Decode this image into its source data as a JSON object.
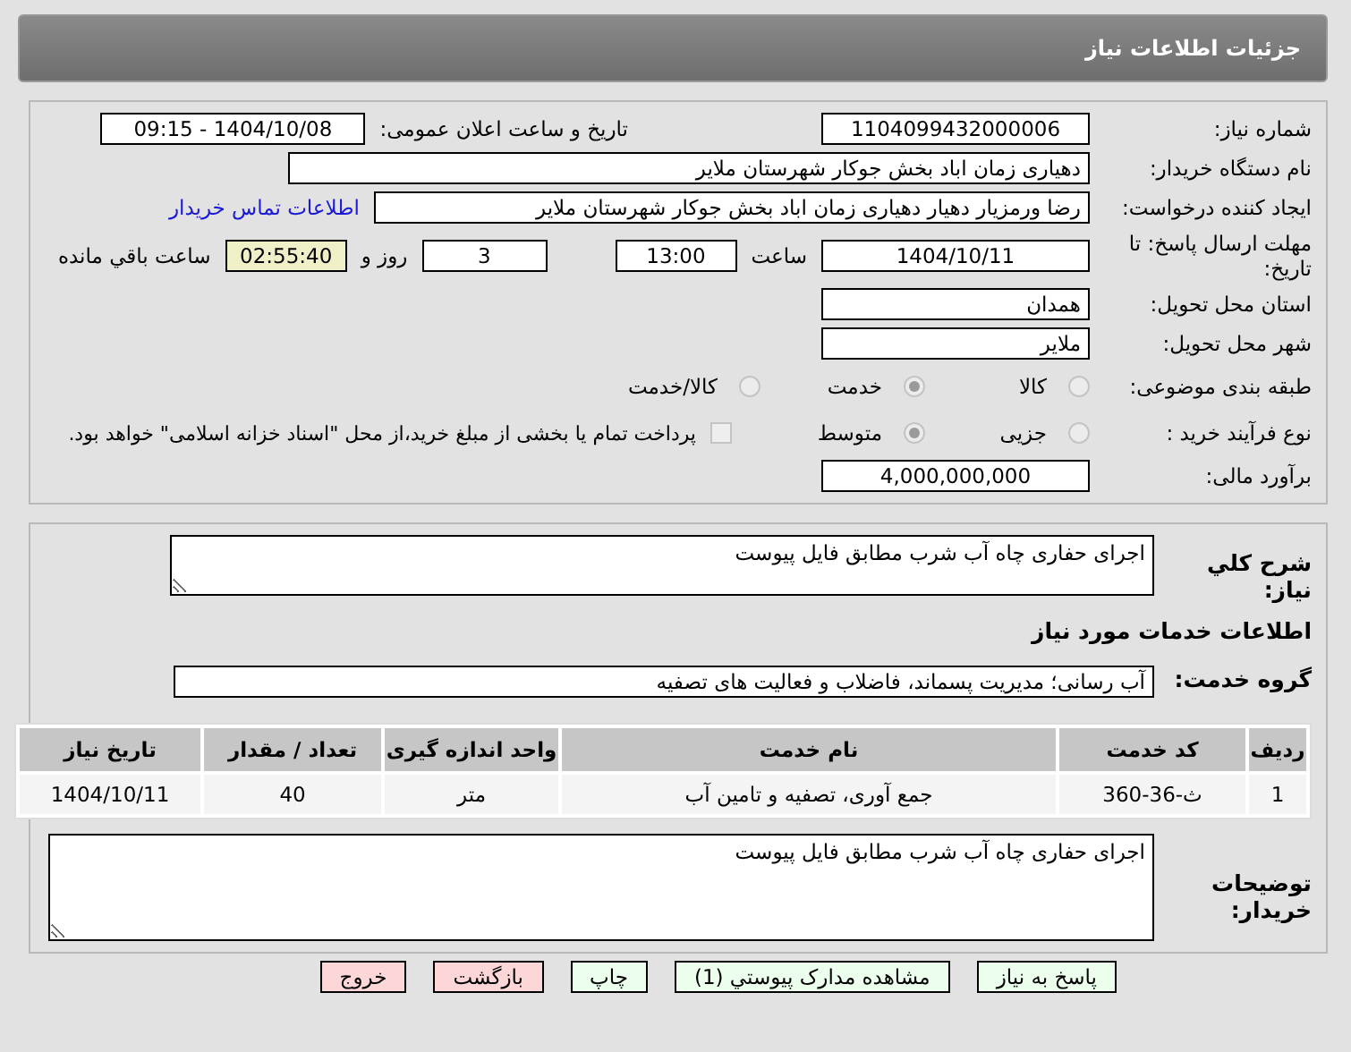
{
  "header": {
    "title": "جزئیات اطلاعات نیاز"
  },
  "need_number": {
    "label": "شماره نیاز:",
    "value": "1104099432000006"
  },
  "announce": {
    "label": "تاریخ و ساعت اعلان عمومی:",
    "value": "1404/10/08 - 09:15"
  },
  "buyer_org": {
    "label": "نام دستگاه خریدار:",
    "value": "دهیاری زمان اباد بخش جوکار شهرستان ملایر"
  },
  "creator": {
    "label": "ایجاد کننده درخواست:",
    "value": "رضا ورمزیار دهیار دهیاری زمان اباد بخش جوکار شهرستان ملایر",
    "link": "اطلاعات تماس خریدار"
  },
  "deadline": {
    "label": "مهلت ارسال پاسخ: تا تاریخ:",
    "date": "1404/10/11",
    "time_label": "ساعت",
    "time": "13:00",
    "days": "3",
    "days_label": "روز و",
    "remaining": "02:55:40",
    "remaining_label": "ساعت باقي مانده"
  },
  "province": {
    "label": "استان محل تحویل:",
    "value": "همدان"
  },
  "city": {
    "label": "شهر محل تحویل:",
    "value": "ملایر"
  },
  "category": {
    "label": "طبقه بندی موضوعی:",
    "options": [
      {
        "label": "کالا",
        "selected": false
      },
      {
        "label": "خدمت",
        "selected": true
      },
      {
        "label": "کالا/خدمت",
        "selected": false
      }
    ]
  },
  "process": {
    "label": "نوع فرآیند خرید :",
    "options": [
      {
        "label": "جزیی",
        "selected": false
      },
      {
        "label": "متوسط",
        "selected": true
      }
    ],
    "payment": {
      "checked": false,
      "text": "پرداخت تمام یا بخشی از مبلغ خرید،از محل \"اسناد خزانه اسلامی\" خواهد بود."
    }
  },
  "estimate": {
    "label": "برآورد مالی:",
    "value": "4,000,000,000"
  },
  "description": {
    "label": "شرح کلي نیاز:",
    "value": "اجرای حفاری چاه آب شرب مطابق فایل پیوست"
  },
  "services_heading": "اطلاعات خدمات مورد نیاز",
  "service_group": {
    "label": "گروه خدمت:",
    "value": "آب رسانی؛ مدیریت پسماند، فاضلاب و فعالیت های تصفیه"
  },
  "table": {
    "columns": [
      "ردیف",
      "کد خدمت",
      "نام خدمت",
      "واحد اندازه گیری",
      "تعداد / مقدار",
      "تاریخ نیاز"
    ],
    "rows": [
      [
        "1",
        "ث-36-360",
        "جمع آوری، تصفیه و تامین آب",
        "متر",
        "40",
        "1404/10/11"
      ]
    ]
  },
  "buyer_notes": {
    "label": "توضیحات خریدار:",
    "value": "اجرای حفاری چاه آب شرب مطابق فایل پیوست"
  },
  "buttons": [
    {
      "label": "پاسخ به نیاز",
      "kind": "normal"
    },
    {
      "label": "مشاهده مدارک پیوستي (1)",
      "kind": "normal"
    },
    {
      "label": "چاپ",
      "kind": "normal"
    },
    {
      "label": "بازگشت",
      "kind": "danger"
    },
    {
      "label": "خروج",
      "kind": "danger"
    }
  ]
}
